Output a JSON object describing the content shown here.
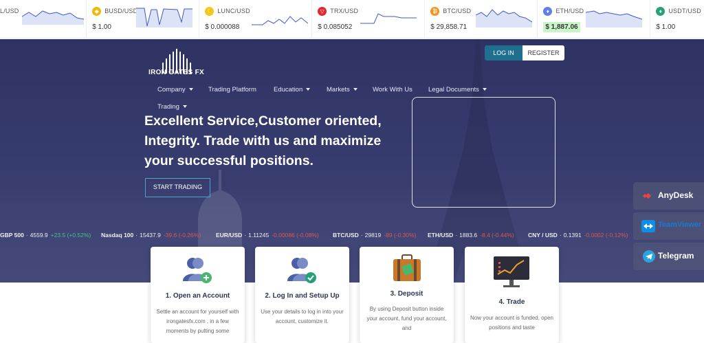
{
  "ticker": [
    {
      "pair": "L/USD",
      "price": "",
      "icon": "tether-icon",
      "color": "#26a17b"
    },
    {
      "pair": "BUSD/USD",
      "price": "$ 1.00",
      "icon": "busd-icon",
      "color": "#f0b90b"
    },
    {
      "pair": "LUNC/USD",
      "price": "$ 0.000088",
      "icon": "lunc-icon",
      "color": "#f5c518"
    },
    {
      "pair": "TRX/USD",
      "price": "$ 0.085052",
      "icon": "trx-icon",
      "color": "#e3262f"
    },
    {
      "pair": "BTC/USD",
      "price": "$ 29,858.71",
      "icon": "btc-icon",
      "color": "#f7931a"
    },
    {
      "pair": "ETH/USD",
      "price": "$ 1,887.06",
      "icon": "eth-icon",
      "color": "#627eea",
      "highlight": true
    },
    {
      "pair": "USDT/USD",
      "price": "$ 1.00",
      "icon": "usdt-icon",
      "color": "#26a17b"
    }
  ],
  "brand": {
    "name": "IRON GATES FX"
  },
  "auth": {
    "login": "LOG IN",
    "register": "REGISTER"
  },
  "nav": [
    {
      "label": "Company",
      "caret": true
    },
    {
      "label": "Trading Platform",
      "caret": false
    },
    {
      "label": "Education",
      "caret": true
    },
    {
      "label": "Markets",
      "caret": true
    },
    {
      "label": "Work With Us",
      "caret": false
    },
    {
      "label": "Legal Documents",
      "caret": true
    },
    {
      "label": "Trading",
      "caret": true
    }
  ],
  "hero": {
    "headline": "Excellent Service,Customer oriented, Integrity. Trade with us and maximize your successful positions.",
    "cta": "START TRADING"
  },
  "markets": [
    {
      "name": "GBP 500",
      "value": "4559.9",
      "change": "+23.5 (+0.52%)",
      "dir": "pos"
    },
    {
      "name": "Nasdaq 100",
      "value": "15437.9",
      "change": "-39.6 (-0.26%)",
      "dir": "neg"
    },
    {
      "name": "EUR/USD",
      "value": "1.11245",
      "change": "-0.00086 (-0.08%)",
      "dir": "neg"
    },
    {
      "name": "BTC/USD",
      "value": "29819",
      "change": "-89 (-0.30%)",
      "dir": "neg"
    },
    {
      "name": "ETH/USD",
      "value": "1883.6",
      "change": "-8.4 (-0.44%)",
      "dir": "neg"
    },
    {
      "name": "CNY / USD",
      "value": "0.1391",
      "change": "-0.0002 (-0.12%)",
      "dir": "neg"
    }
  ],
  "support": [
    {
      "label": "AnyDesk",
      "icon": "anydesk-icon"
    },
    {
      "label": "TeamViewer",
      "icon": "teamviewer-icon"
    },
    {
      "label": "Telegram",
      "icon": "telegram-icon"
    }
  ],
  "steps": [
    {
      "title": "1. Open an Account",
      "desc": "Settle an account for yourself with irongatesfx.com , in a few moments by putting some",
      "icon": "add-user-icon"
    },
    {
      "title": "2. Log In and Setup Up",
      "desc": "Use your details to log in into your account, customize it.",
      "icon": "verified-user-icon"
    },
    {
      "title": "3. Deposit",
      "desc": "By using Deposit button inside your account, fund your account, and",
      "icon": "suitcase-money-icon"
    },
    {
      "title": "4. Trade",
      "desc": "Now your account is funded, open positions and taste",
      "icon": "chart-monitor-icon"
    }
  ]
}
